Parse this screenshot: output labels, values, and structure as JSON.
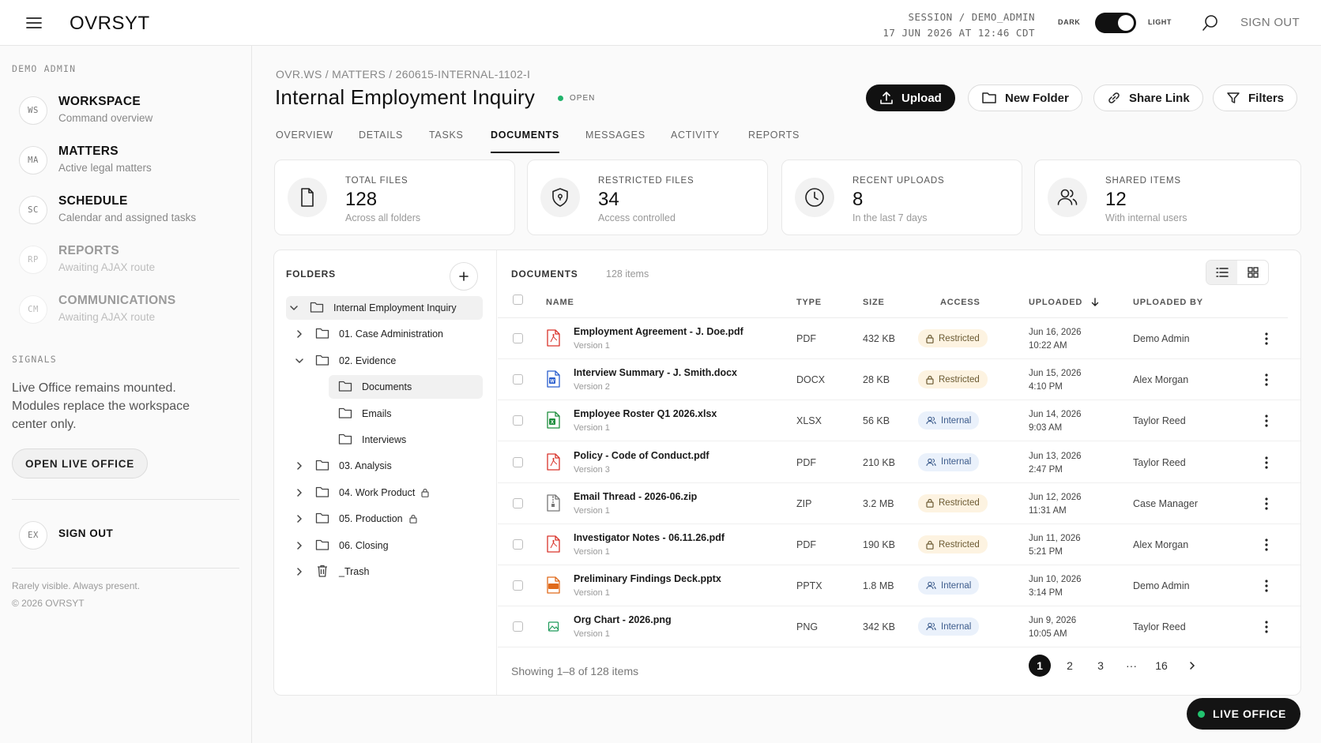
{
  "topbar": {
    "brand": "OVRSYT",
    "session_line1": "SESSION / DEMO_ADMIN",
    "session_line2": "17 JUN 2026 AT 12:46 CDT",
    "theme_dark": "DARK",
    "theme_light": "LIGHT",
    "sign_out": "SIGN OUT"
  },
  "sidebar": {
    "section_label": "DEMO ADMIN",
    "items": [
      {
        "badge": "WS",
        "title": "WORKSPACE",
        "sub": "Command overview"
      },
      {
        "badge": "MA",
        "title": "MATTERS",
        "sub": "Active legal matters"
      },
      {
        "badge": "SC",
        "title": "SCHEDULE",
        "sub": "Calendar and assigned tasks"
      },
      {
        "badge": "RP",
        "title": "REPORTS",
        "sub": "Awaiting AJAX route"
      },
      {
        "badge": "CM",
        "title": "COMMUNICATIONS",
        "sub": "Awaiting AJAX route"
      }
    ],
    "signals_label": "SIGNALS",
    "signals_text": "Live Office remains mounted. Modules replace the workspace center only.",
    "open_live_office": "OPEN LIVE OFFICE",
    "signout_badge": "EX",
    "signout_label": "SIGN OUT",
    "footer_line1": "Rarely visible. Always present.",
    "footer_line2": "© 2026 OVRSYT"
  },
  "main": {
    "breadcrumb": "OVR.WS / MATTERS / 260615-INTERNAL-1102-I",
    "title": "Internal Employment Inquiry",
    "status": "OPEN",
    "actions": {
      "upload": "Upload",
      "new_folder": "New Folder",
      "share_link": "Share Link",
      "filters": "Filters"
    },
    "tabs": [
      "OVERVIEW",
      "DETAILS",
      "TASKS",
      "DOCUMENTS",
      "MESSAGES",
      "ACTIVITY",
      "REPORTS"
    ],
    "active_tab": "DOCUMENTS",
    "stats": [
      {
        "label": "TOTAL FILES",
        "value": "128",
        "sub": "Across all folders",
        "icon": "file-icon"
      },
      {
        "label": "RESTRICTED FILES",
        "value": "34",
        "sub": "Access controlled",
        "icon": "shield-icon"
      },
      {
        "label": "RECENT UPLOADS",
        "value": "8",
        "sub": "In the last 7 days",
        "icon": "clock-icon"
      },
      {
        "label": "SHARED ITEMS",
        "value": "12",
        "sub": "With internal users",
        "icon": "users-icon"
      }
    ]
  },
  "folders": {
    "heading": "FOLDERS",
    "tree": [
      {
        "label": "Internal Employment Inquiry",
        "level": 0,
        "chevron": "down",
        "selected": true,
        "lock": false,
        "icon": "folder"
      },
      {
        "label": "01. Case Administration",
        "level": 1,
        "chevron": "right",
        "selected": false,
        "lock": false,
        "icon": "folder"
      },
      {
        "label": "02. Evidence",
        "level": 1,
        "chevron": "down",
        "selected": false,
        "lock": false,
        "icon": "folder"
      },
      {
        "label": "Documents",
        "level": 2,
        "chevron": "none",
        "selected": true,
        "lock": false,
        "icon": "folder"
      },
      {
        "label": "Emails",
        "level": 2,
        "chevron": "none",
        "selected": false,
        "lock": false,
        "icon": "folder"
      },
      {
        "label": "Interviews",
        "level": 2,
        "chevron": "none",
        "selected": false,
        "lock": false,
        "icon": "folder"
      },
      {
        "label": "03. Analysis",
        "level": 1,
        "chevron": "right",
        "selected": false,
        "lock": false,
        "icon": "folder"
      },
      {
        "label": "04. Work Product",
        "level": 1,
        "chevron": "right",
        "selected": false,
        "lock": true,
        "icon": "folder"
      },
      {
        "label": "05. Production",
        "level": 1,
        "chevron": "right",
        "selected": false,
        "lock": true,
        "icon": "folder"
      },
      {
        "label": "06. Closing",
        "level": 1,
        "chevron": "right",
        "selected": false,
        "lock": false,
        "icon": "folder"
      },
      {
        "label": "_Trash",
        "level": 1,
        "chevron": "right",
        "selected": false,
        "lock": false,
        "icon": "trash"
      }
    ]
  },
  "documents": {
    "heading": "DOCUMENTS",
    "count": "128 items",
    "columns": {
      "name": "NAME",
      "type": "TYPE",
      "size": "SIZE",
      "access": "ACCESS",
      "uploaded": "UPLOADED",
      "uploaded_by": "UPLOADED BY"
    },
    "rows": [
      {
        "name": "Employment Agreement - J. Doe.pdf",
        "version": "Version 1",
        "type": "PDF",
        "size": "432 KB",
        "access": "Restricted",
        "date": "Jun 16, 2026",
        "time": "10:22 AM",
        "by": "Demo Admin",
        "kind": "pdf"
      },
      {
        "name": "Interview Summary - J. Smith.docx",
        "version": "Version 2",
        "type": "DOCX",
        "size": "28 KB",
        "access": "Restricted",
        "date": "Jun 15, 2026",
        "time": "4:10 PM",
        "by": "Alex Morgan",
        "kind": "docx"
      },
      {
        "name": "Employee Roster Q1 2026.xlsx",
        "version": "Version 1",
        "type": "XLSX",
        "size": "56 KB",
        "access": "Internal",
        "date": "Jun 14, 2026",
        "time": "9:03 AM",
        "by": "Taylor Reed",
        "kind": "xlsx"
      },
      {
        "name": "Policy - Code of Conduct.pdf",
        "version": "Version 3",
        "type": "PDF",
        "size": "210 KB",
        "access": "Internal",
        "date": "Jun 13, 2026",
        "time": "2:47 PM",
        "by": "Taylor Reed",
        "kind": "pdf"
      },
      {
        "name": "Email Thread - 2026-06.zip",
        "version": "Version 1",
        "type": "ZIP",
        "size": "3.2 MB",
        "access": "Restricted",
        "date": "Jun 12, 2026",
        "time": "11:31 AM",
        "by": "Case Manager",
        "kind": "zip"
      },
      {
        "name": "Investigator Notes - 06.11.26.pdf",
        "version": "Version 1",
        "type": "PDF",
        "size": "190 KB",
        "access": "Restricted",
        "date": "Jun 11, 2026",
        "time": "5:21 PM",
        "by": "Alex Morgan",
        "kind": "pdf"
      },
      {
        "name": "Preliminary Findings Deck.pptx",
        "version": "Version 1",
        "type": "PPTX",
        "size": "1.8 MB",
        "access": "Internal",
        "date": "Jun 10, 2026",
        "time": "3:14 PM",
        "by": "Demo Admin",
        "kind": "pptx"
      },
      {
        "name": "Org Chart - 2026.png",
        "version": "Version 1",
        "type": "PNG",
        "size": "342 KB",
        "access": "Internal",
        "date": "Jun 9, 2026",
        "time": "10:05 AM",
        "by": "Taylor Reed",
        "kind": "png"
      }
    ],
    "showing": "Showing 1–8 of 128 items",
    "pages": [
      "1",
      "2",
      "3",
      "···",
      "16"
    ],
    "current_page": "1"
  },
  "live_office": "LIVE OFFICE",
  "colors": {
    "accent": "#111111",
    "status_open": "#21b36b",
    "pdf": "#d9342b",
    "docx": "#2b5fce",
    "xlsx": "#1f8f3e",
    "zip": "#777777",
    "pptx": "#e06a1b",
    "png": "#1f9a5a",
    "restricted_bg": "#fdf3e1",
    "internal_bg": "#eaf1fb",
    "live_dot": "#22c36f"
  }
}
